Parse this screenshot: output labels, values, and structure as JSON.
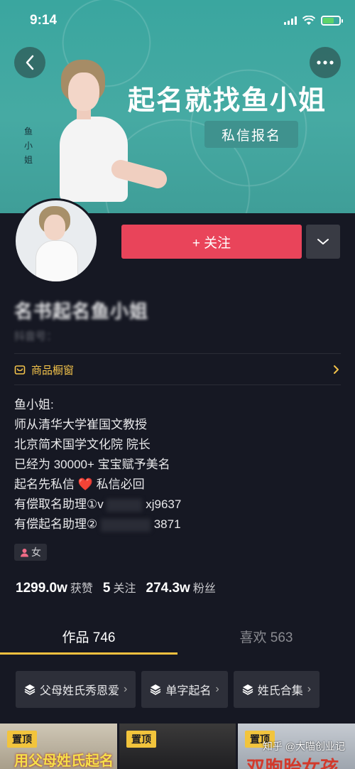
{
  "status_bar": {
    "time": "9:14"
  },
  "banner": {
    "title": "起名就找鱼小姐",
    "cta_label": "私信报名",
    "vertical_name": "鱼小姐"
  },
  "profile": {
    "follow_label": "+ 关注",
    "nickname": "名书起名鱼小姐",
    "account_id": "抖音号：",
    "shop_label": "商品橱窗",
    "bio": [
      "鱼小姐:",
      "师从清华大学崔国文教授",
      "北京简术国学文化院  院长",
      "已经为 30000+ 宝宝赋予美名",
      "起名先私信",
      "私信必回",
      "有偿取名助理①v",
      "xj9637",
      "有偿起名助理②",
      "3871"
    ],
    "gender": "女"
  },
  "stats": [
    {
      "value": "1299.0w",
      "label": "获赞"
    },
    {
      "value": "5",
      "label": "关注"
    },
    {
      "value": "274.3w",
      "label": "粉丝"
    }
  ],
  "tabs": [
    {
      "label": "作品 746",
      "active": true
    },
    {
      "label": "喜欢 563",
      "active": false
    }
  ],
  "collections": [
    {
      "label": "父母姓氏秀恩爱"
    },
    {
      "label": "单字起名"
    },
    {
      "label": "姓氏合集"
    }
  ],
  "videos": [
    {
      "badge": "置顶",
      "caption": "用父母姓氏起名"
    },
    {
      "badge": "置顶",
      "caption": ""
    },
    {
      "badge": "置顶",
      "caption": "双胞胎女孩"
    }
  ],
  "watermark": "知乎 @大喵创业记",
  "colors": {
    "accent": "#e9445a",
    "highlight": "#f6c03f",
    "background": "#161823",
    "banner": "#46aaa3"
  }
}
